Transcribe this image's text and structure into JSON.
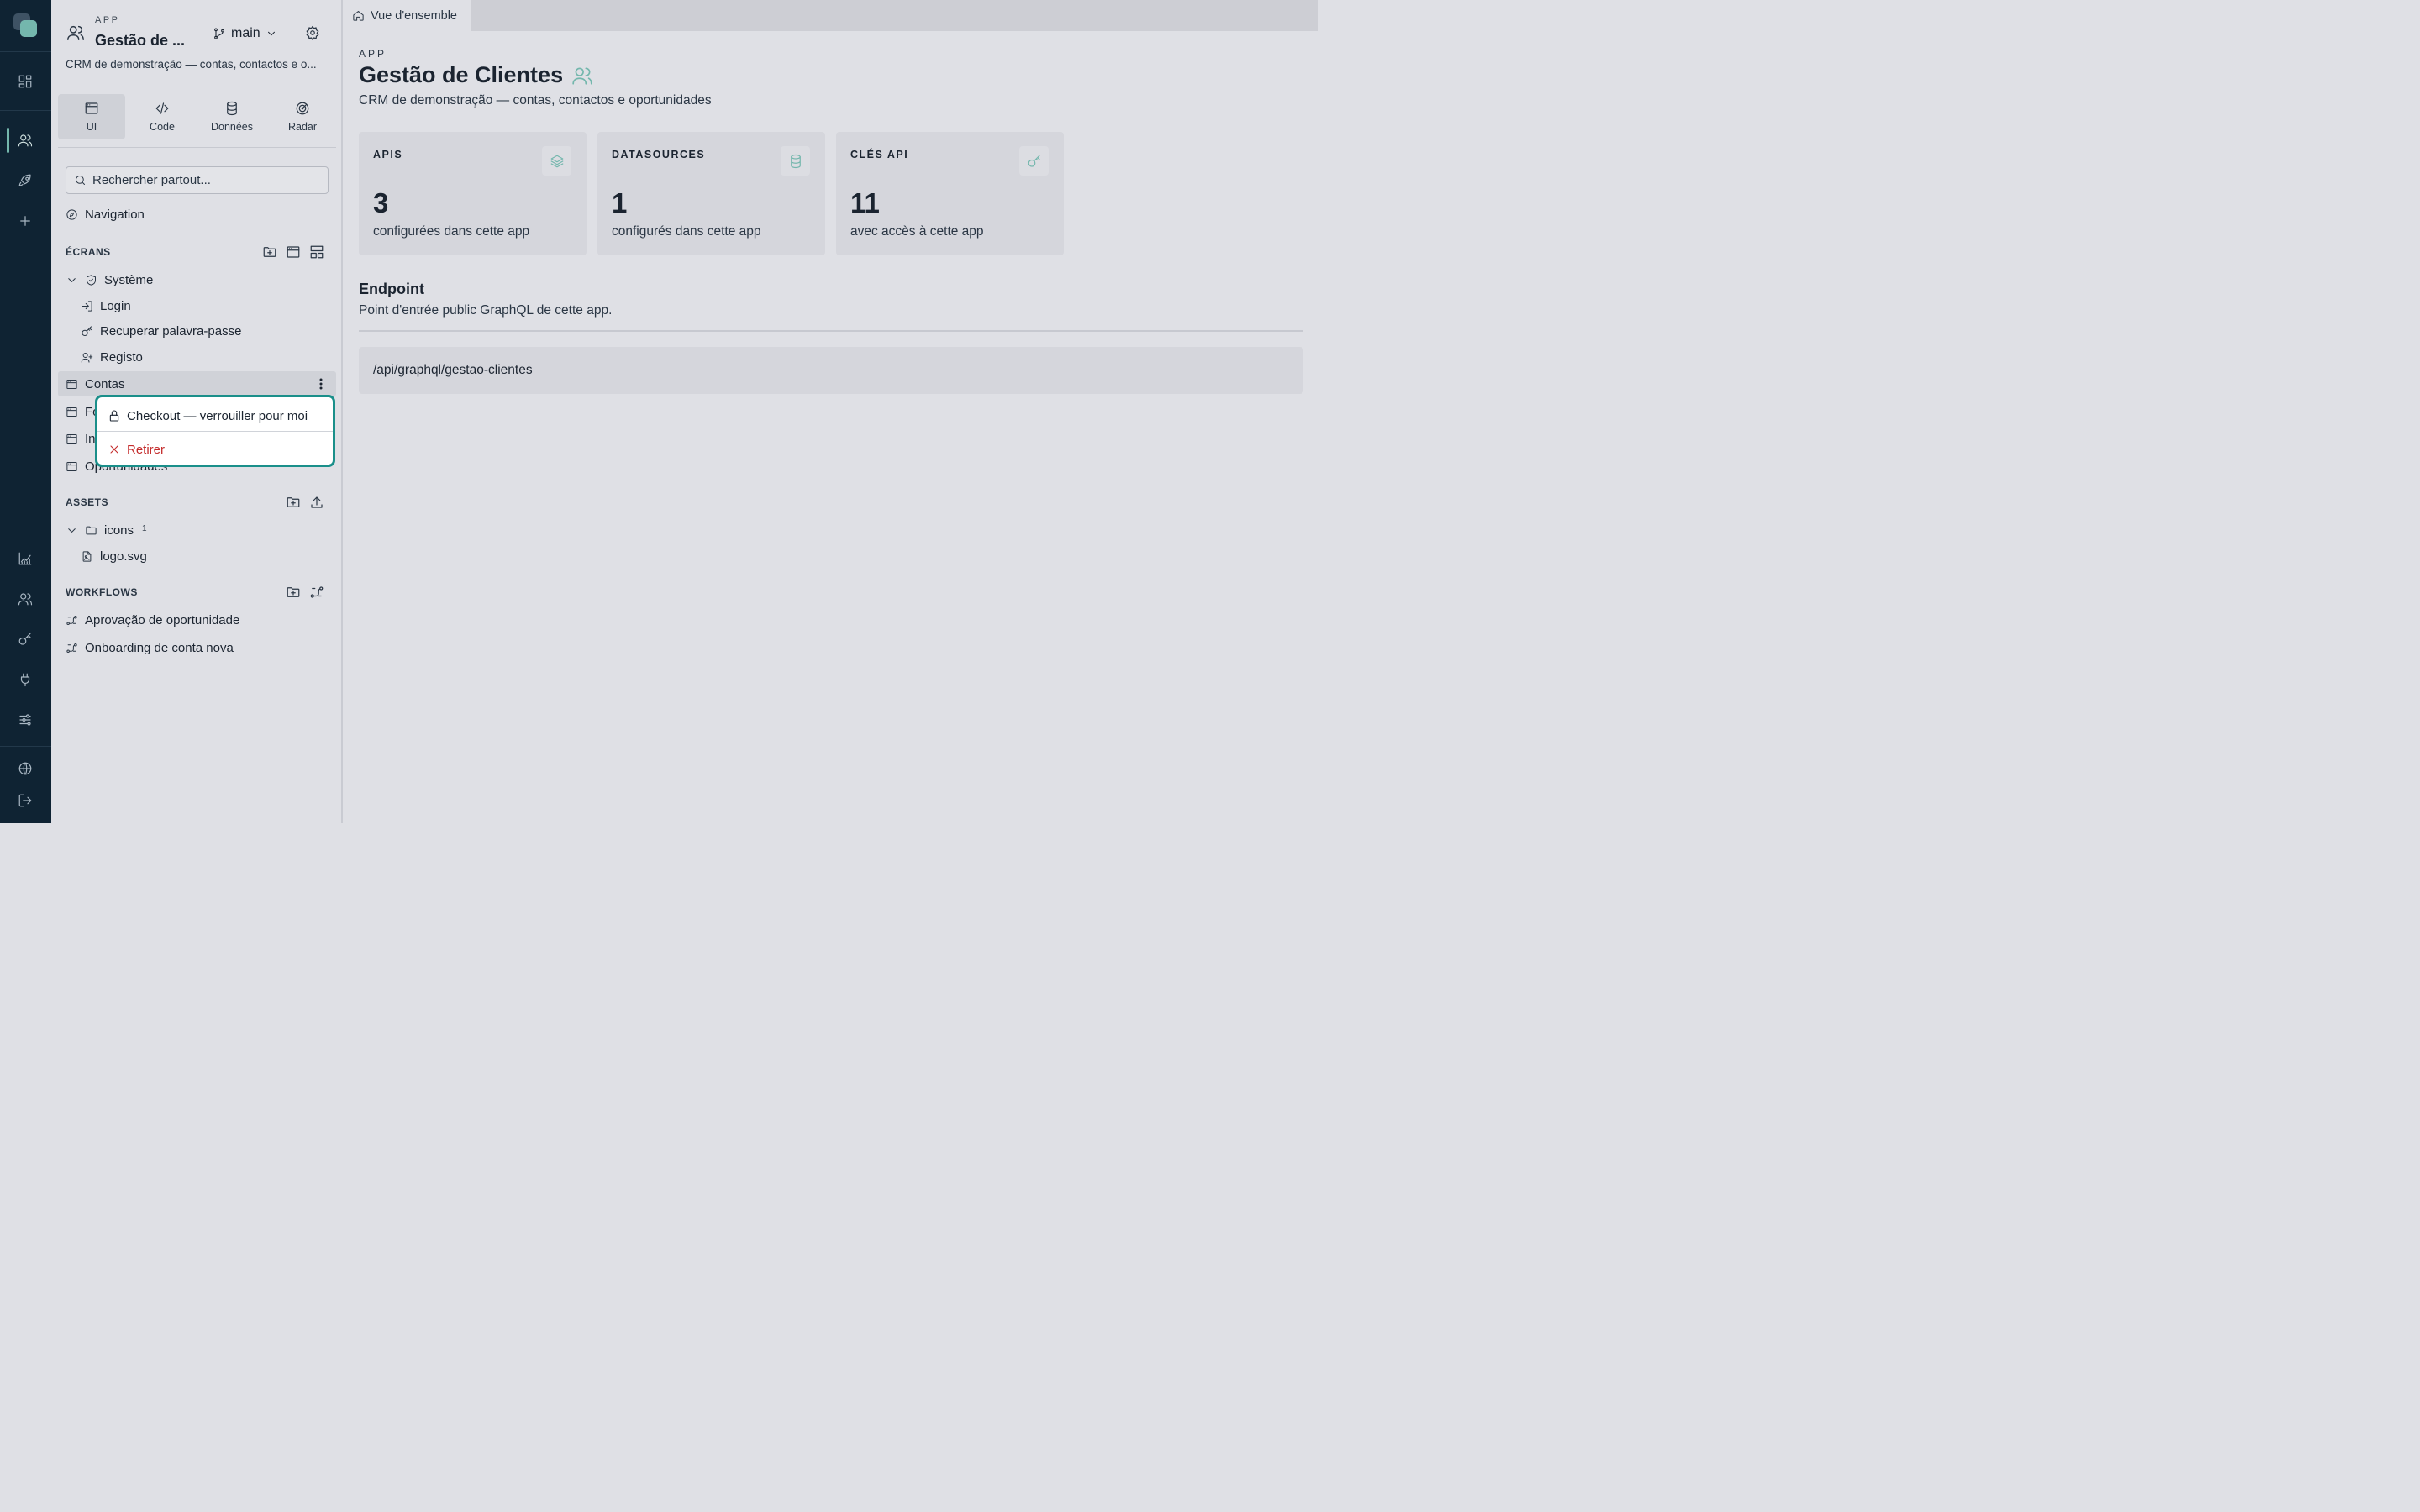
{
  "rail": {
    "icons": [
      "dashboard-icon",
      "users-icon",
      "rocket-icon",
      "plus-icon",
      "chart-icon",
      "team-icon",
      "key-icon",
      "plug-icon",
      "sliders-icon",
      "globe-icon",
      "logout-icon"
    ],
    "accent": "#74b7ad"
  },
  "app": {
    "kicker": "APP",
    "name_short": "Gestão de ...",
    "branch": "main",
    "desc_short": "CRM de demonstração — contas, contactos e o..."
  },
  "tabs": [
    {
      "label": "UI",
      "icon": "window-icon"
    },
    {
      "label": "Code",
      "icon": "code-icon"
    },
    {
      "label": "Données",
      "icon": "database-icon"
    },
    {
      "label": "Radar",
      "icon": "radar-icon"
    }
  ],
  "search": {
    "placeholder": "Rechercher partout..."
  },
  "navigation_label": "Navigation",
  "screens": {
    "heading": "ÉCRANS",
    "folder": "Système",
    "system_items": [
      "Login",
      "Recuperar palavra-passe",
      "Registo"
    ],
    "items": [
      "Contas",
      "Fo",
      "In",
      "Oportunidades"
    ]
  },
  "context_menu": {
    "checkout": "Checkout — verrouiller pour moi",
    "remove": "Retirer",
    "highlight": "#1a8f8a",
    "danger": "#c42b2b"
  },
  "assets": {
    "heading": "ASSETS",
    "folder": "icons",
    "folder_count": "1",
    "file": "logo.svg"
  },
  "workflows": {
    "heading": "WORKFLOWS",
    "items": [
      "Aprovação de oportunidade",
      "Onboarding de conta nova"
    ]
  },
  "main": {
    "tab": "Vue d'ensemble",
    "kicker": "APP",
    "title": "Gestão de Clientes",
    "desc": "CRM de demonstração — contas, contactos e oportunidades",
    "cards": [
      {
        "label": "APIS",
        "value": "3",
        "sub": "configurées dans cette app",
        "icon": "layers-icon"
      },
      {
        "label": "DATASOURCES",
        "value": "1",
        "sub": "configurés dans cette app",
        "icon": "database-icon"
      },
      {
        "label": "CLÉS API",
        "value": "11",
        "sub": "avec accès à cette app",
        "icon": "key-icon"
      }
    ],
    "endpoint_title": "Endpoint",
    "endpoint_desc": "Point d'entrée public GraphQL de cette app.",
    "endpoint_url": "/api/graphql/gestao-clientes"
  }
}
